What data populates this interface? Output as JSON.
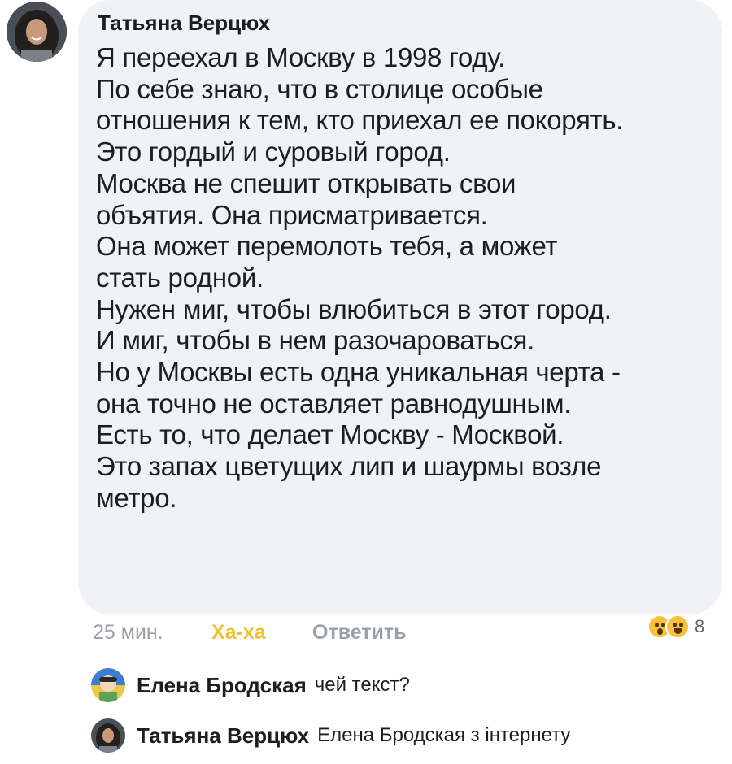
{
  "comment": {
    "author": "Татьяна Верцюх",
    "lines": [
      "Я переехал в Москву в 1998 году.",
      "По себе знаю, что в столице особые",
      "отношения к тем, кто приехал ее покорять.",
      "Это гордый и суровый город.",
      "Москва не спешит открывать свои",
      "объятия. Она присматривается.",
      "Она может перемолоть тебя, а может",
      "стать родной.",
      "Нужен миг, чтобы влюбиться в этот город.",
      "И миг, чтобы в нем разочароваться.",
      "Но у Москвы есть одна уникальная черта -",
      "она точно не оставляет равнодушным.",
      "Есть то, что делает Москву - Москвой.",
      "Это запах цветущих лип и шаурмы возле",
      "метро."
    ],
    "time": "25 мин.",
    "haha_label": "Ха-ха",
    "reply_label": "Ответить",
    "reaction_count": "8",
    "reaction_icons": [
      "wow-emoji-icon",
      "haha-emoji-icon"
    ]
  },
  "replies": [
    {
      "author": "Елена Бродская",
      "text": "чей текст?"
    },
    {
      "author": "Татьяна Верцюх",
      "text": "Елена Бродская з інтернету"
    }
  ],
  "colors": {
    "bubble": "#f0f2f5",
    "haha_accent": "#f2c12e",
    "muted": "#9ba0a6"
  }
}
